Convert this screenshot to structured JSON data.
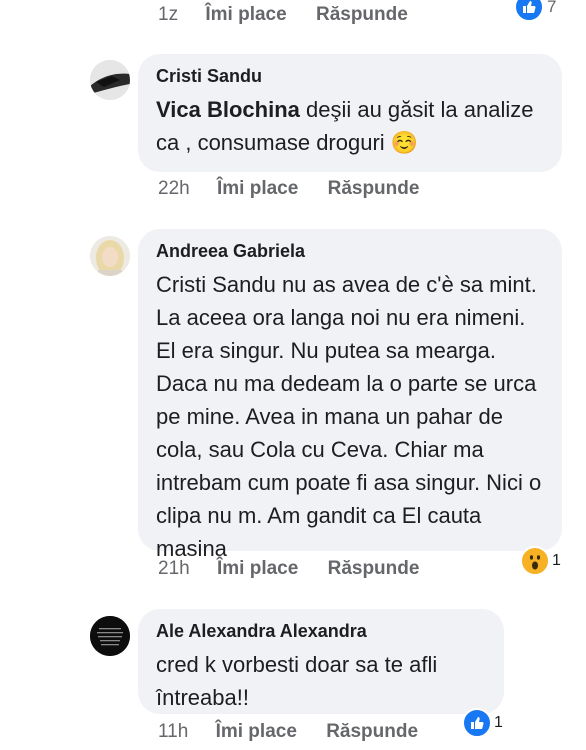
{
  "top_row": {
    "time": "1z",
    "like": "Îmi place",
    "reply": "Răspunde",
    "reaction_count": "7",
    "reaction_icon": "like-icon"
  },
  "comments": [
    {
      "author": "Cristi Sandu",
      "mention": "Vica Blochina",
      "text": " deşii au găsit la analize ca , consumase droguri ☺️",
      "time": "22h",
      "like": "Îmi place",
      "reply": "Răspunde"
    },
    {
      "author": "Andreea Gabriela",
      "text": "Cristi Sandu nu as avea de c'è sa mint. La aceea ora langa noi nu era nimeni. El era singur. Nu putea sa mearga. Daca nu ma dedeam la o parte se urca pe mine. Avea in mana un pahar de cola, sau Cola cu Ceva. Chiar ma intrebam cum poate fi asa singur. Nici o clipa nu m. Am gandit ca El cauta masina",
      "time": "21h",
      "like": "Îmi place",
      "reply": "Răspunde",
      "reaction_icon": "wow-icon",
      "reaction_count": "1"
    },
    {
      "author": "Ale Alexandra Alexandra",
      "text": "cred k vorbesti doar sa te afli întreaba!!",
      "time": "11h",
      "like": "Îmi place",
      "reply": "Răspunde",
      "reaction_icon": "like-icon",
      "reaction_count": "1"
    }
  ],
  "colors": {
    "bubble": "#f0f2f5",
    "meta": "#65676b",
    "like_blue": "#1877f2",
    "wow_yellow": "#f7b125"
  }
}
